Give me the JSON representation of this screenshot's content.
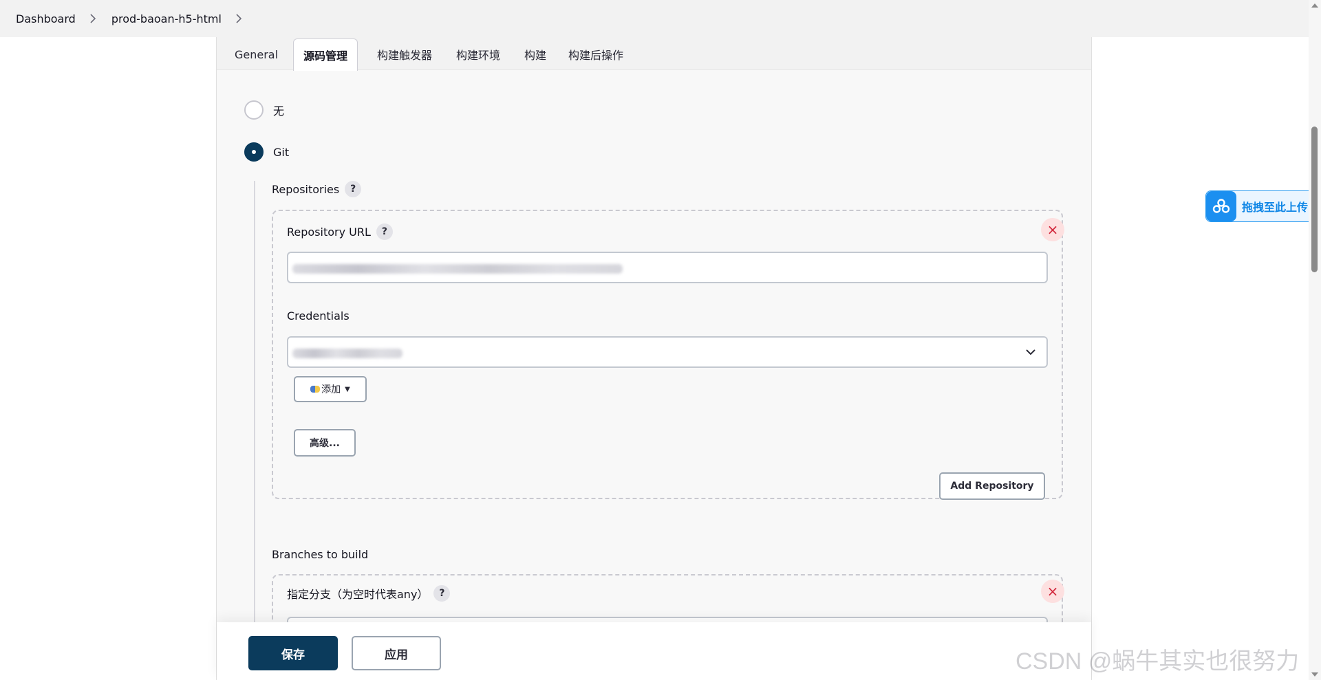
{
  "breadcrumb": {
    "items": [
      "Dashboard",
      "prod-baoan-h5-html"
    ]
  },
  "tabs": [
    {
      "label": "General",
      "active": false
    },
    {
      "label": "源码管理",
      "active": true
    },
    {
      "label": "构建触发器",
      "active": false
    },
    {
      "label": "构建环境",
      "active": false
    },
    {
      "label": "构建",
      "active": false
    },
    {
      "label": "构建后操作",
      "active": false
    }
  ],
  "scm": {
    "options": [
      {
        "label": "无",
        "checked": false
      },
      {
        "label": "Git",
        "checked": true
      }
    ]
  },
  "git": {
    "repositories_label": "Repositories",
    "help": "?",
    "repository_url_label": "Repository URL",
    "credentials_label": "Credentials",
    "add_button": "添加",
    "advanced_button": "高级...",
    "add_repository_button": "Add Repository",
    "remove_symbol": "×",
    "branches_label": "Branches to build",
    "branch_spec_label": "指定分支（为空时代表any）"
  },
  "actions": {
    "save": "保存",
    "apply": "应用"
  },
  "upload_widget": {
    "label": "拖拽至此上传",
    "icon": "cloud-upload-icon"
  },
  "watermark": "CSDN @蜗牛其实也很努力",
  "colors": {
    "primary": "#0b3b5c",
    "remove": "#d2263b",
    "upload": "#1b8ff0"
  }
}
